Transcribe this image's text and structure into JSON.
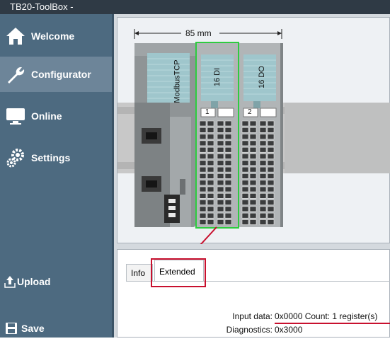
{
  "window": {
    "title": "TB20-ToolBox -"
  },
  "sidebar": {
    "items": [
      {
        "label": "Welcome",
        "icon": "home-icon"
      },
      {
        "label": "Configurator",
        "icon": "wrench-icon"
      },
      {
        "label": "Online",
        "icon": "monitor-icon"
      },
      {
        "label": "Settings",
        "icon": "gears-icon"
      },
      {
        "label": "Upload",
        "icon": "upload-icon"
      },
      {
        "label": "Save",
        "icon": "save-icon"
      }
    ]
  },
  "configurator": {
    "width_label": "85 mm",
    "coupler_label": "ModbusTCP",
    "modules": [
      {
        "slot": "1",
        "label": "16 DI"
      },
      {
        "slot": "2",
        "label": "16 DO"
      }
    ]
  },
  "details": {
    "tabs": [
      "Info",
      "Extended"
    ],
    "input_label": "Input data:",
    "input_value": "0x0000 Count: 1 register(s)",
    "diag_label": "Diagnostics:",
    "diag_value": "0x3000"
  },
  "colors": {
    "sidebar": "#4d6a80",
    "active_item": "#6d8599",
    "highlight_green": "#2ecc40",
    "annotation_red": "#c8102e"
  }
}
